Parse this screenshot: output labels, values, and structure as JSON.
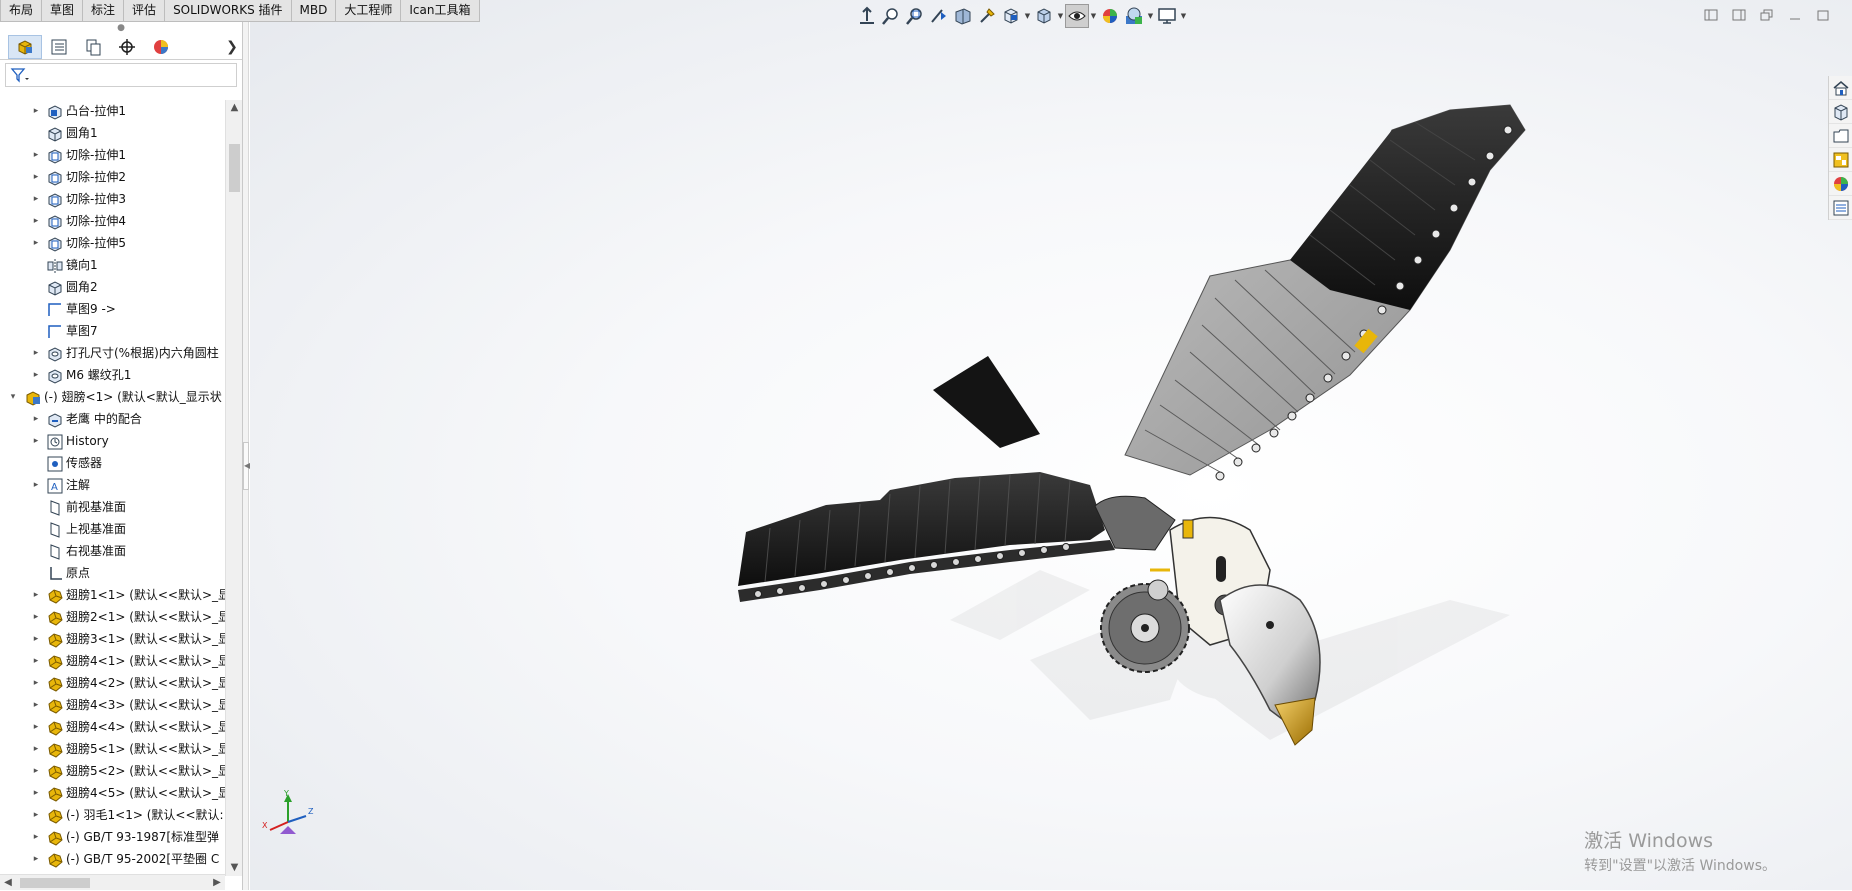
{
  "tabs": [
    "布局",
    "草图",
    "标注",
    "评估",
    "SOLIDWORKS 插件",
    "MBD",
    "大工程师",
    "Ican工具箱"
  ],
  "feature_tree": {
    "rows": [
      {
        "label": "凸台-拉伸1",
        "icon": "extrude-icon",
        "level": 1,
        "expand": true
      },
      {
        "label": "圆角1",
        "icon": "fillet-icon",
        "level": 1,
        "expand": false
      },
      {
        "label": "切除-拉伸1",
        "icon": "cut-extrude-icon",
        "level": 1,
        "expand": true
      },
      {
        "label": "切除-拉伸2",
        "icon": "cut-extrude-icon",
        "level": 1,
        "expand": true
      },
      {
        "label": "切除-拉伸3",
        "icon": "cut-extrude-icon",
        "level": 1,
        "expand": true
      },
      {
        "label": "切除-拉伸4",
        "icon": "cut-extrude-icon",
        "level": 1,
        "expand": true
      },
      {
        "label": "切除-拉伸5",
        "icon": "cut-extrude-icon",
        "level": 1,
        "expand": true
      },
      {
        "label": "镜向1",
        "icon": "mirror-icon",
        "level": 1,
        "expand": false
      },
      {
        "label": "圆角2",
        "icon": "fillet-icon",
        "level": 1,
        "expand": false
      },
      {
        "label": "草图9 ->",
        "icon": "sketch-icon",
        "level": 1,
        "expand": false
      },
      {
        "label": "草图7",
        "icon": "sketch-icon",
        "level": 1,
        "expand": false
      },
      {
        "label": "打孔尺寸(%根据)内六角圆柱",
        "icon": "hole-wizard-icon",
        "level": 1,
        "expand": true
      },
      {
        "label": "M6 螺纹孔1",
        "icon": "hole-wizard-icon",
        "level": 1,
        "expand": true
      },
      {
        "label": "(-) 翅膀<1> (默认<默认_显示状",
        "icon": "assembly-icon",
        "level": 0,
        "expand": true,
        "expanded": true
      },
      {
        "label": "老鹰 中的配合",
        "icon": "mates-icon",
        "level": 1,
        "expand": true
      },
      {
        "label": "History",
        "icon": "history-icon",
        "level": 1,
        "expand": true
      },
      {
        "label": "传感器",
        "icon": "sensor-icon",
        "level": 1,
        "expand": false
      },
      {
        "label": "注解",
        "icon": "annotation-icon",
        "level": 1,
        "expand": true
      },
      {
        "label": "前视基准面",
        "icon": "plane-icon",
        "level": 1,
        "expand": false
      },
      {
        "label": "上视基准面",
        "icon": "plane-icon",
        "level": 1,
        "expand": false
      },
      {
        "label": "右视基准面",
        "icon": "plane-icon",
        "level": 1,
        "expand": false
      },
      {
        "label": "原点",
        "icon": "origin-icon",
        "level": 1,
        "expand": false
      },
      {
        "label": "翅膀1<1> (默认<<默认>_显",
        "icon": "part-icon",
        "level": 1,
        "expand": true
      },
      {
        "label": "翅膀2<1> (默认<<默认>_显",
        "icon": "part-icon",
        "level": 1,
        "expand": true
      },
      {
        "label": "翅膀3<1> (默认<<默认>_显",
        "icon": "part-icon",
        "level": 1,
        "expand": true
      },
      {
        "label": "翅膀4<1> (默认<<默认>_显",
        "icon": "part-icon",
        "level": 1,
        "expand": true
      },
      {
        "label": "翅膀4<2> (默认<<默认>_显",
        "icon": "part-icon",
        "level": 1,
        "expand": true
      },
      {
        "label": "翅膀4<3> (默认<<默认>_显",
        "icon": "part-icon",
        "level": 1,
        "expand": true
      },
      {
        "label": "翅膀4<4> (默认<<默认>_显",
        "icon": "part-icon",
        "level": 1,
        "expand": true
      },
      {
        "label": "翅膀5<1> (默认<<默认>_显",
        "icon": "part-icon",
        "level": 1,
        "expand": true
      },
      {
        "label": "翅膀5<2> (默认<<默认>_显",
        "icon": "part-icon",
        "level": 1,
        "expand": true
      },
      {
        "label": "翅膀4<5> (默认<<默认>_显",
        "icon": "part-icon",
        "level": 1,
        "expand": true
      },
      {
        "label": "(-) 羽毛1<1> (默认<<默认:",
        "icon": "part-icon",
        "level": 1,
        "expand": true
      },
      {
        "label": "(-) GB/T 93-1987[标准型弹",
        "icon": "part-icon",
        "level": 1,
        "expand": true
      },
      {
        "label": "(-) GB/T 95-2002[平垫圈 C",
        "icon": "part-icon",
        "level": 1,
        "expand": true
      }
    ]
  },
  "viewport": {
    "triad_labels": {
      "x": "X",
      "y": "Y",
      "z": "Z"
    },
    "activation_line1": "激活 Windows",
    "activation_line2": "转到\"设置\"以激活 Windows。"
  },
  "colors": {
    "accent": "#1f5fbf",
    "part_yellow": "#e8b60a",
    "feather_dark": "#1b1b1b",
    "feather_gray": "#9a9a9a"
  }
}
